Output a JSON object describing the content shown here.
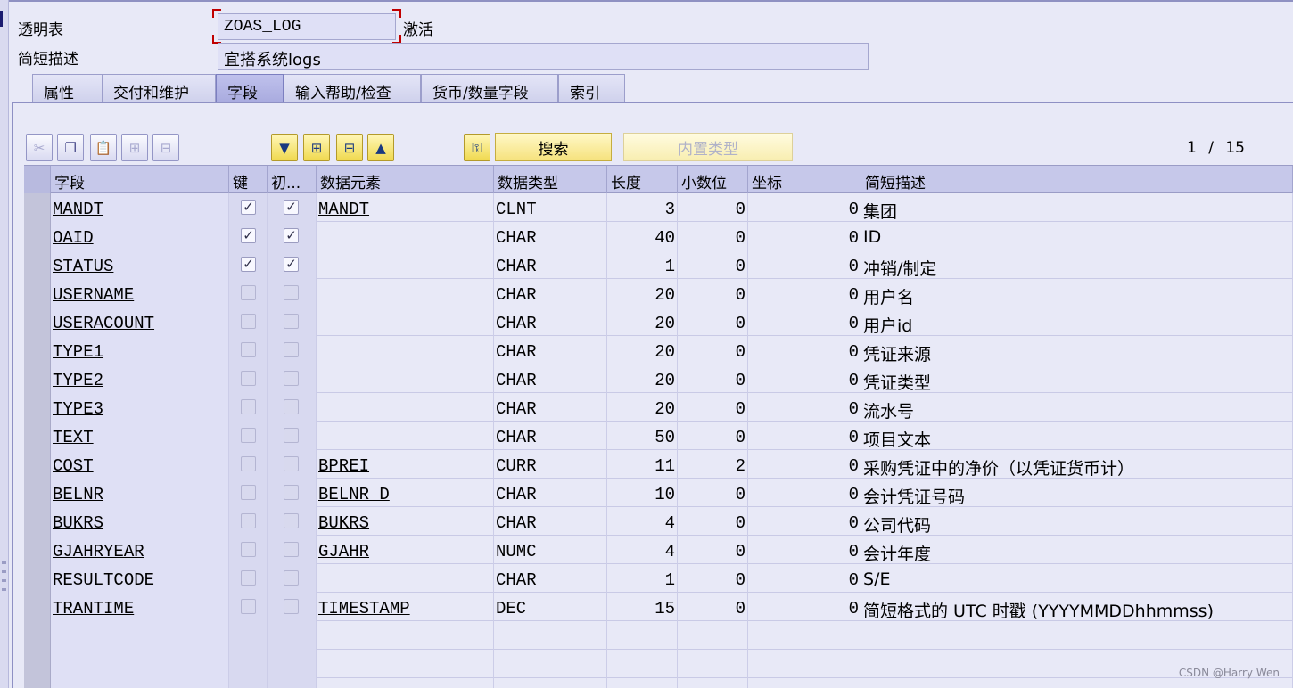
{
  "header": {
    "table_label": "透明表",
    "table_name": "ZOAS_LOG",
    "status": "激活",
    "desc_label": "简短描述",
    "desc_value": "宜搭系统logs"
  },
  "tabs": [
    {
      "label": "属性",
      "active": false
    },
    {
      "label": "交付和维护",
      "active": false
    },
    {
      "label": "字段",
      "active": true
    },
    {
      "label": "输入帮助/检查",
      "active": false
    },
    {
      "label": "货币/数量字段",
      "active": false
    },
    {
      "label": "索引",
      "active": false
    }
  ],
  "toolbar": {
    "icons": [
      "cut-icon",
      "copy-icon",
      "paste-icon",
      "insert-row-icon",
      "delete-row-icon",
      "move-down-icon",
      "expand-icon",
      "collapse-icon",
      "move-up-icon",
      "key-icon"
    ],
    "search_label": "搜索",
    "builtin_type_label": "内置类型",
    "pager_current": "1",
    "pager_sep": "/",
    "pager_total": "15"
  },
  "columns": {
    "field": "字段",
    "key": "键",
    "init": "初...",
    "data_element": "数据元素",
    "data_type": "数据类型",
    "length": "长度",
    "decimals": "小数位",
    "coord": "坐标",
    "short_desc": "简短描述"
  },
  "rows": [
    {
      "field": "MANDT",
      "key": true,
      "init": true,
      "elem": "MANDT",
      "type": "CLNT",
      "len": "3",
      "dec": "0",
      "coord": "0",
      "desc": "集团"
    },
    {
      "field": "OAID",
      "key": true,
      "init": true,
      "elem": "",
      "type": "CHAR",
      "len": "40",
      "dec": "0",
      "coord": "0",
      "desc": "ID"
    },
    {
      "field": "STATUS",
      "key": true,
      "init": true,
      "elem": "",
      "type": "CHAR",
      "len": "1",
      "dec": "0",
      "coord": "0",
      "desc": "冲销/制定"
    },
    {
      "field": "USERNAME",
      "key": false,
      "init": false,
      "elem": "",
      "type": "CHAR",
      "len": "20",
      "dec": "0",
      "coord": "0",
      "desc": "用户名"
    },
    {
      "field": "USERACOUNT",
      "key": false,
      "init": false,
      "elem": "",
      "type": "CHAR",
      "len": "20",
      "dec": "0",
      "coord": "0",
      "desc": "用户id"
    },
    {
      "field": "TYPE1",
      "key": false,
      "init": false,
      "elem": "",
      "type": "CHAR",
      "len": "20",
      "dec": "0",
      "coord": "0",
      "desc": "凭证来源"
    },
    {
      "field": "TYPE2",
      "key": false,
      "init": false,
      "elem": "",
      "type": "CHAR",
      "len": "20",
      "dec": "0",
      "coord": "0",
      "desc": "凭证类型"
    },
    {
      "field": "TYPE3",
      "key": false,
      "init": false,
      "elem": "",
      "type": "CHAR",
      "len": "20",
      "dec": "0",
      "coord": "0",
      "desc": "流水号"
    },
    {
      "field": "TEXT",
      "key": false,
      "init": false,
      "elem": "",
      "type": "CHAR",
      "len": "50",
      "dec": "0",
      "coord": "0",
      "desc": "项目文本"
    },
    {
      "field": "COST",
      "key": false,
      "init": false,
      "elem": "BPREI",
      "type": "CURR",
      "len": "11",
      "dec": "2",
      "coord": "0",
      "desc": "采购凭证中的净价（以凭证货币计）"
    },
    {
      "field": "BELNR",
      "key": false,
      "init": false,
      "elem": "BELNR_D",
      "type": "CHAR",
      "len": "10",
      "dec": "0",
      "coord": "0",
      "desc": "会计凭证号码"
    },
    {
      "field": "BUKRS",
      "key": false,
      "init": false,
      "elem": "BUKRS",
      "type": "CHAR",
      "len": "4",
      "dec": "0",
      "coord": "0",
      "desc": "公司代码"
    },
    {
      "field": "GJAHRYEAR",
      "key": false,
      "init": false,
      "elem": "GJAHR",
      "type": "NUMC",
      "len": "4",
      "dec": "0",
      "coord": "0",
      "desc": "会计年度"
    },
    {
      "field": "RESULTCODE",
      "key": false,
      "init": false,
      "elem": "",
      "type": "CHAR",
      "len": "1",
      "dec": "0",
      "coord": "0",
      "desc": "S/E"
    },
    {
      "field": "TRANTIME",
      "key": false,
      "init": false,
      "elem": "TIMESTAMP",
      "type": "DEC",
      "len": "15",
      "dec": "0",
      "coord": "0",
      "desc": "简短格式的 UTC 时戳 (YYYYMMDDhhmmss)"
    }
  ],
  "empty_rows": 3,
  "watermark": "CSDN @Harry Wen"
}
